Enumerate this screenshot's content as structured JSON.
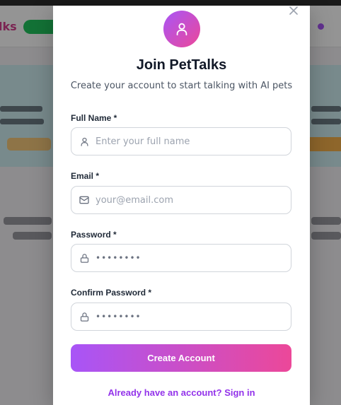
{
  "background": {
    "logo_fragment": "lks"
  },
  "modal": {
    "title": "Join PetTalks",
    "subtitle": "Create your account to start talking with AI pets",
    "fields": [
      {
        "label": "Full Name *",
        "placeholder": "Enter your full name",
        "value": "",
        "icon": "user-icon"
      },
      {
        "label": "Email *",
        "placeholder": "your@email.com",
        "value": "",
        "icon": "mail-icon"
      },
      {
        "label": "Password *",
        "placeholder": "",
        "value": "••••••••",
        "icon": "lock-icon"
      },
      {
        "label": "Confirm Password *",
        "placeholder": "",
        "value": "••••••••",
        "icon": "lock-icon"
      }
    ],
    "submit_label": "Create Account",
    "signin_label": "Already have an account? Sign in"
  },
  "colors": {
    "accent_start": "#a855f7",
    "accent_end": "#ec4899",
    "link": "#9333ea"
  }
}
